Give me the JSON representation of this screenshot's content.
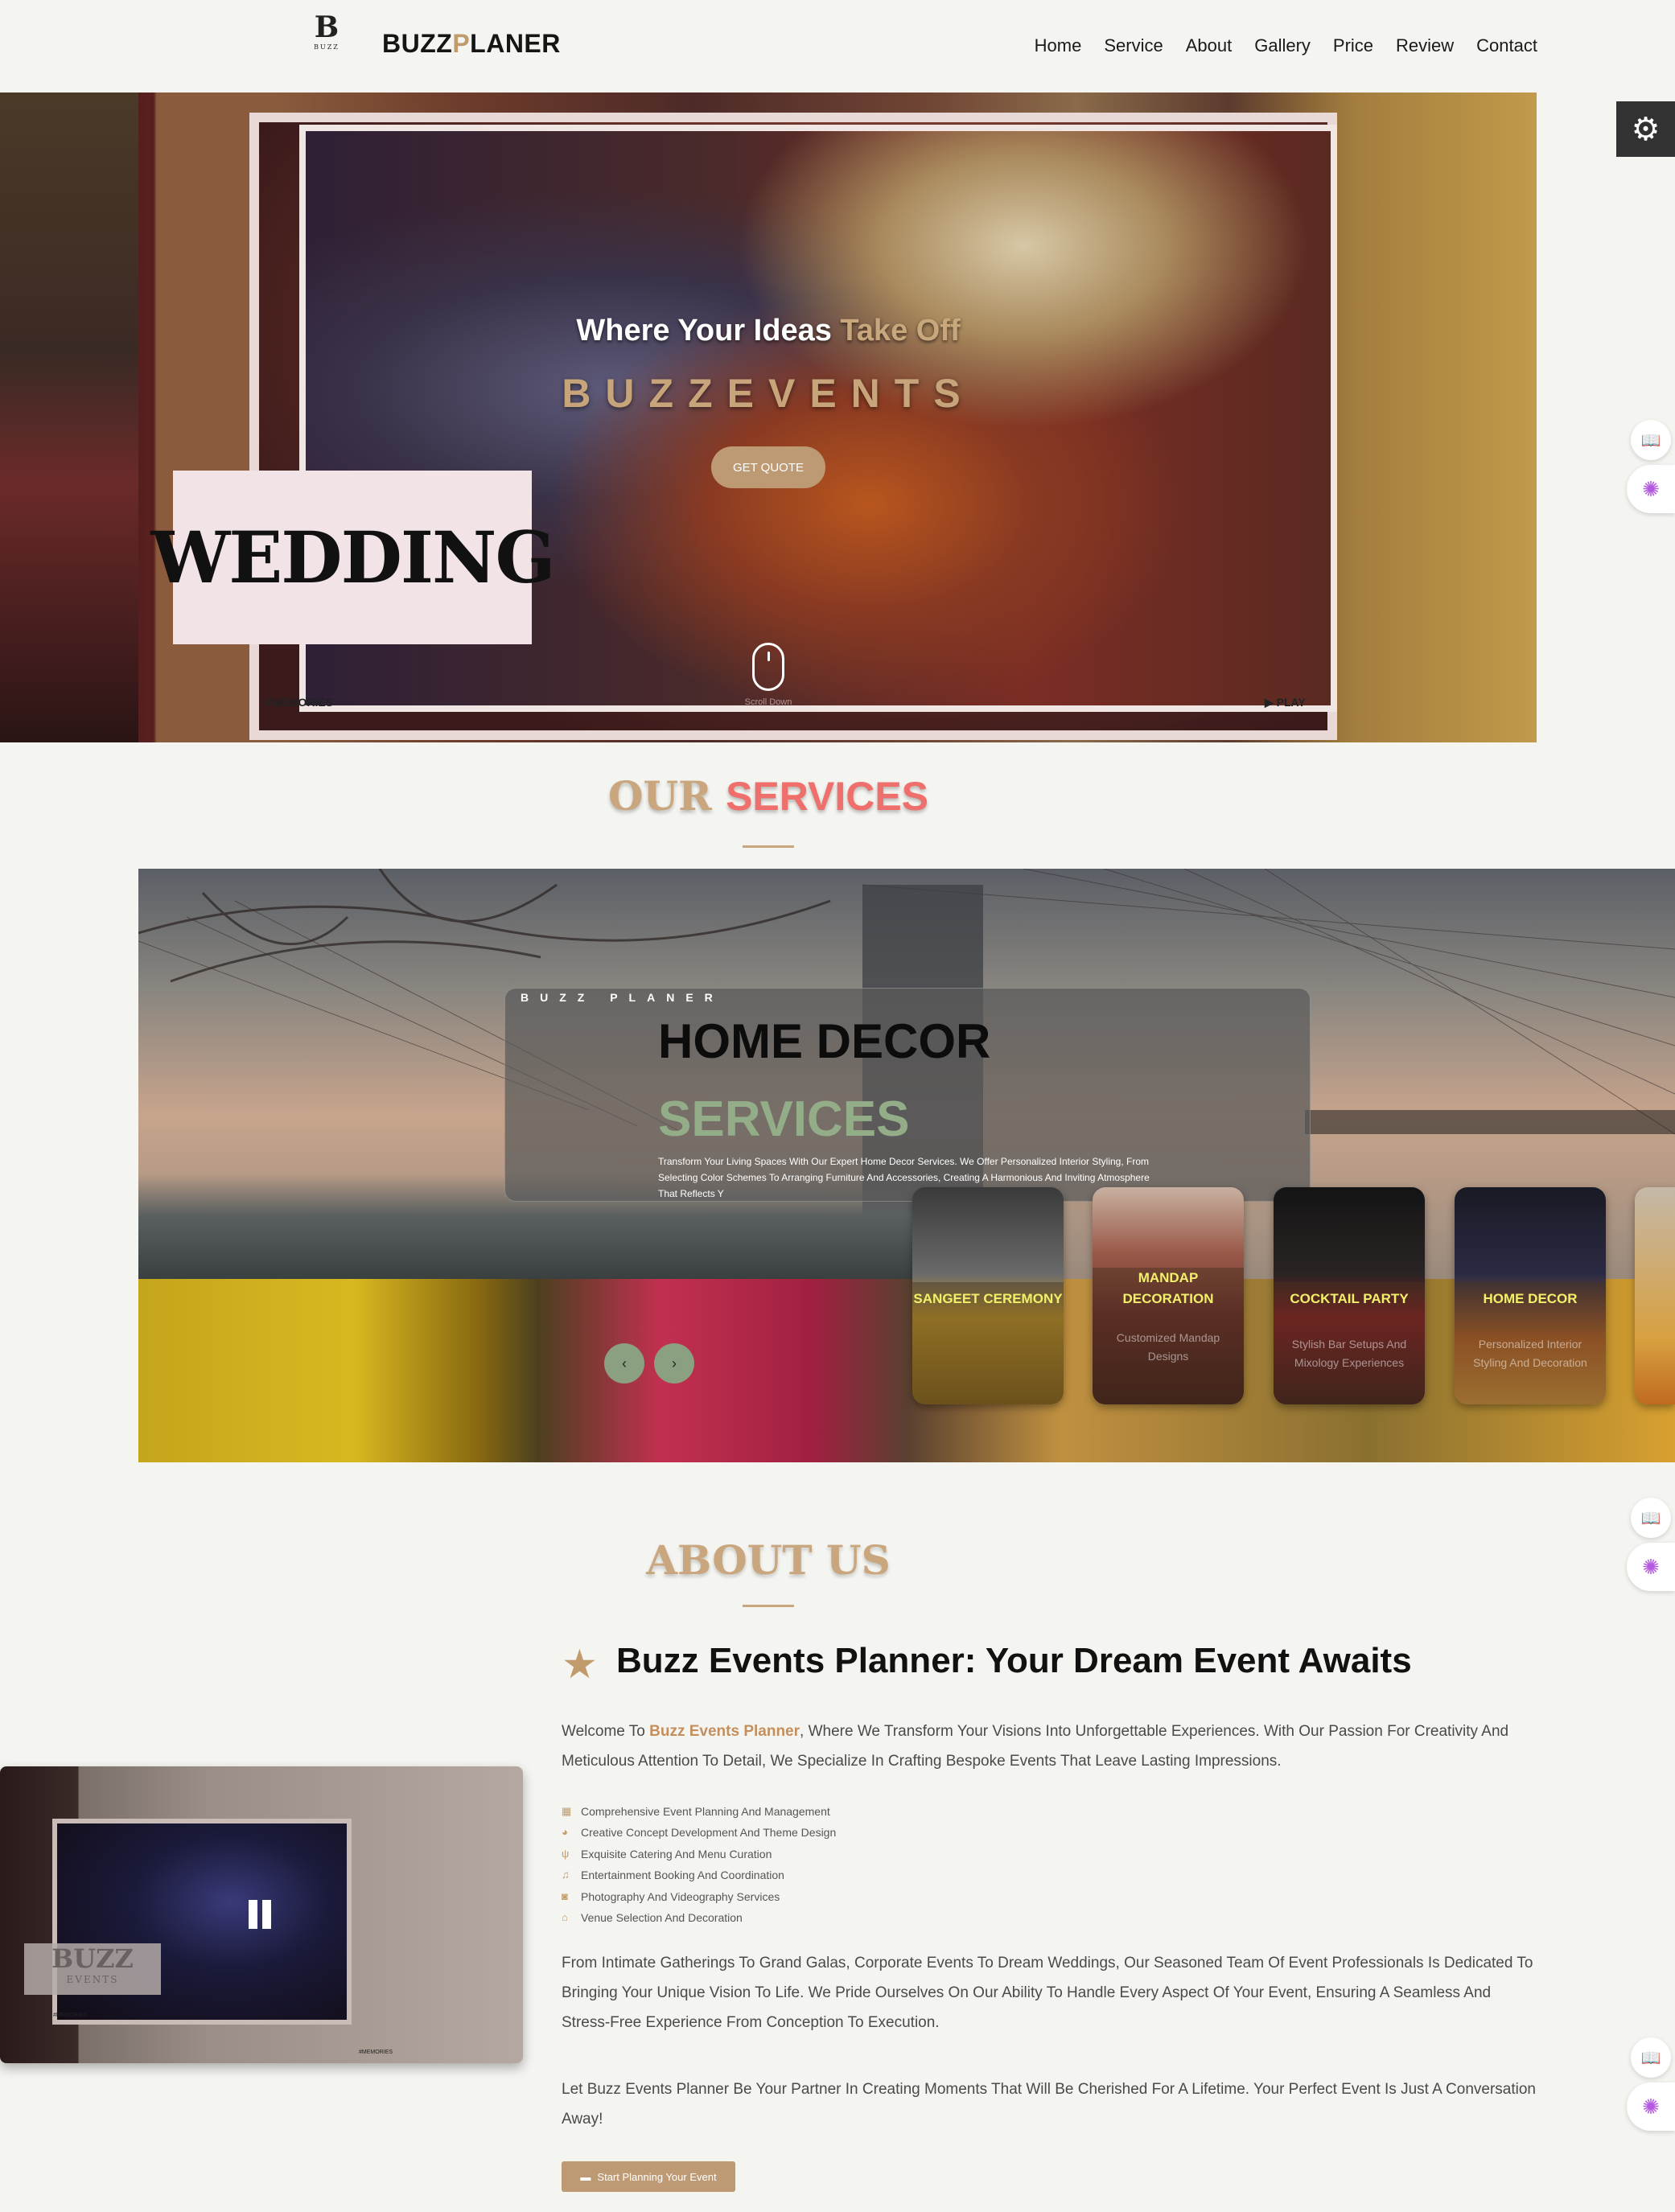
{
  "header": {
    "logo_mark": "B",
    "logo_small": "BUZZ",
    "brand_part1": "BUZZ",
    "brand_part2": "P",
    "brand_part3": "LANER",
    "nav": [
      "Home",
      "Service",
      "About",
      "Gallery",
      "Price",
      "Review",
      "Contact"
    ]
  },
  "hero": {
    "tagline_1": "Where Your Ideas ",
    "tagline_2": "Take Off",
    "brand": "BUZZEVENTS",
    "get_quote": "GET QUOTE",
    "wedding": "WEDDING",
    "scroll_label": "Scroll Down",
    "memories": "#MEMORIES",
    "play": "PLAY"
  },
  "services": {
    "title_1": "OUR ",
    "title_2": "SERVICES",
    "slide": {
      "kicker": "BUZZ PLANER",
      "title": "HOME DECOR",
      "subtitle": "SERVICES",
      "description": "Transform Your Living Spaces With Our Expert Home Decor Services. We Offer Personalized Interior Styling, From Selecting Color Schemes To Arranging Furniture And Accessories, Creating A Harmonious And Inviting Atmosphere That Reflects Y"
    },
    "thumbs": [
      {
        "title": "SANGEET CEREMONY",
        "desc": ""
      },
      {
        "title": "MANDAP DECORATION",
        "desc": "Customized Mandap Designs"
      },
      {
        "title": "COCKTAIL PARTY",
        "desc": "Stylish Bar Setups And Mixology Experiences"
      },
      {
        "title": "HOME DECOR",
        "desc": "Personalized Interior Styling And Decoration"
      }
    ],
    "prev": "‹",
    "next": "›"
  },
  "about": {
    "title": "ABOUT US",
    "heading": "Buzz Events Planner: Your Dream Event Awaits",
    "intro_1": "Welcome To ",
    "intro_hl": "Buzz Events Planner",
    "intro_2": ", Where We Transform Your Visions Into Unforgettable Experiences. With Our Passion For Creativity And Meticulous Attention To Detail, We Specialize In Crafting Bespoke Events That Leave Lasting Impressions.",
    "features": [
      {
        "icon": "calendar-icon",
        "glyph": "▦",
        "text": "Comprehensive Event Planning And Management"
      },
      {
        "icon": "palette-icon",
        "glyph": "◕",
        "text": "Creative Concept Development And Theme Design"
      },
      {
        "icon": "utensils-icon",
        "glyph": "ψ",
        "text": "Exquisite Catering And Menu Curation"
      },
      {
        "icon": "music-icon",
        "glyph": "♫",
        "text": "Entertainment Booking And Coordination"
      },
      {
        "icon": "camera-icon",
        "glyph": "◙",
        "text": "Photography And Videography Services"
      },
      {
        "icon": "venue-icon",
        "glyph": "⌂",
        "text": "Venue Selection And Decoration"
      }
    ],
    "para_2": "From Intimate Gatherings To Grand Galas, Corporate Events To Dream Weddings, Our Seasoned Team Of Event Professionals Is Dedicated To Bringing Your Unique Vision To Life. We Pride Ourselves On Our Ability To Handle Every Aspect Of Your Event, Ensuring A Seamless And Stress-Free Experience From Conception To Execution.",
    "para_3": "Let Buzz Events Planner Be Your Partner In Creating Moments That Will Be Cherished For A Lifetime. Your Perfect Event Is Just A Conversation Away!",
    "cta": "Start Planning Your Event",
    "video_buzz": "BUZZ",
    "video_events": "EVENTS",
    "video_mem": "#MEMORIES"
  },
  "colors": {
    "accent": "#c19b6c",
    "coral": "#ee6f6b",
    "sage": "#93ad88",
    "dark_btn": "#323232"
  }
}
